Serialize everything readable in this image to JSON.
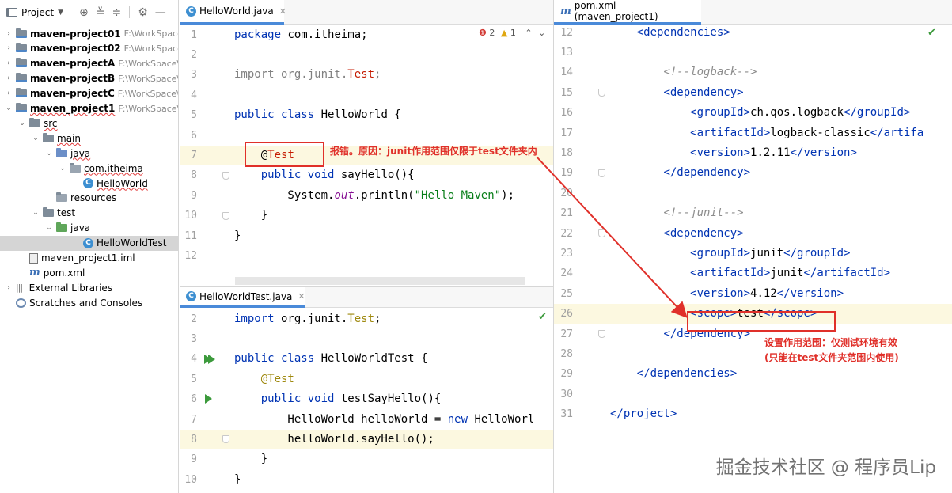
{
  "project": {
    "title": "Project",
    "tree": [
      {
        "label": "maven-project01",
        "path": "F:\\WorkSpace\\it",
        "bold": true,
        "arrow": "›",
        "icon": "module",
        "indent": 0
      },
      {
        "label": "maven-project02",
        "path": "F:\\WorkSpace\\it",
        "bold": true,
        "arrow": "›",
        "icon": "module",
        "indent": 0
      },
      {
        "label": "maven-projectA",
        "path": "F:\\WorkSpace\\it",
        "bold": true,
        "arrow": "›",
        "icon": "module",
        "indent": 0
      },
      {
        "label": "maven-projectB",
        "path": "F:\\WorkSpace\\it",
        "bold": true,
        "arrow": "›",
        "icon": "module",
        "indent": 0
      },
      {
        "label": "maven-projectC",
        "path": "F:\\WorkSpace\\it",
        "bold": true,
        "arrow": "›",
        "icon": "module",
        "indent": 0
      },
      {
        "label": "maven_project1",
        "path": "F:\\WorkSpace\\it",
        "bold": true,
        "arrow": "⌄",
        "icon": "module",
        "indent": 0,
        "squiggle": true
      },
      {
        "label": "src",
        "path": "",
        "arrow": "⌄",
        "icon": "folder",
        "indent": 1,
        "squiggle": true
      },
      {
        "label": "main",
        "path": "",
        "arrow": "⌄",
        "icon": "folder",
        "indent": 2,
        "squiggle": true
      },
      {
        "label": "java",
        "path": "",
        "arrow": "⌄",
        "icon": "src-folder",
        "indent": 3,
        "squiggle": true
      },
      {
        "label": "com.itheima",
        "path": "",
        "arrow": "⌄",
        "icon": "package",
        "indent": 4,
        "squiggle": true
      },
      {
        "label": "HelloWorld",
        "path": "",
        "arrow": "",
        "icon": "class",
        "indent": 5,
        "squiggle": true
      },
      {
        "label": "resources",
        "path": "",
        "arrow": "",
        "icon": "res-folder",
        "indent": 3
      },
      {
        "label": "test",
        "path": "",
        "arrow": "⌄",
        "icon": "folder",
        "indent": 2
      },
      {
        "label": "java",
        "path": "",
        "arrow": "⌄",
        "icon": "test-folder",
        "indent": 3
      },
      {
        "label": "HelloWorldTest",
        "path": "",
        "arrow": "",
        "icon": "class",
        "indent": 5,
        "selected": true
      },
      {
        "label": "maven_project1.iml",
        "path": "",
        "arrow": "",
        "icon": "iml",
        "indent": 1
      },
      {
        "label": "pom.xml",
        "path": "",
        "arrow": "",
        "icon": "maven",
        "indent": 1
      },
      {
        "label": "External Libraries",
        "path": "",
        "arrow": "›",
        "icon": "libs",
        "indent": 0
      },
      {
        "label": "Scratches and Consoles",
        "path": "",
        "arrow": "",
        "icon": "scratch",
        "indent": 0
      }
    ]
  },
  "editor1": {
    "tab": "HelloWorld.java",
    "inspection": {
      "errors": "2",
      "warnings": "1"
    },
    "lines": [
      {
        "n": "1",
        "html": "<span class='kw'>package</span> com.itheima;"
      },
      {
        "n": "2",
        "html": ""
      },
      {
        "n": "3",
        "html": "<span class='gr'>import org.junit.</span><span class='err'>Test</span><span class='gr'>;</span>"
      },
      {
        "n": "4",
        "html": ""
      },
      {
        "n": "5",
        "html": "<span class='kw'>public class</span> HelloWorld {"
      },
      {
        "n": "6",
        "html": ""
      },
      {
        "n": "7",
        "html": "    @<span class='err'>Test</span>",
        "hl": true
      },
      {
        "n": "8",
        "html": "    <span class='kw'>public void</span> sayHello(){"
      },
      {
        "n": "9",
        "html": "        System.<span class='fi'>out</span>.println(<span class='st'>\"Hello Maven\"</span>);"
      },
      {
        "n": "10",
        "html": "    }"
      },
      {
        "n": "11",
        "html": "}"
      },
      {
        "n": "12",
        "html": ""
      }
    ],
    "note": "报错。原因：junit作用范围仅限于test文件夹内"
  },
  "editor2": {
    "tab": "HelloWorldTest.java",
    "lines": [
      {
        "n": "2",
        "html": "<span class='kw'>import</span> org.junit.<span class='an'>Test</span>;"
      },
      {
        "n": "3",
        "html": ""
      },
      {
        "n": "4",
        "html": "<span class='kw'>public class</span> HelloWorldTest {"
      },
      {
        "n": "5",
        "html": "    <span class='an'>@Test</span>"
      },
      {
        "n": "6",
        "html": "    <span class='kw'>public void</span> testSayHello(){"
      },
      {
        "n": "7",
        "html": "        HelloWorld helloWorld = <span class='kw'>new</span> HelloWorl"
      },
      {
        "n": "8",
        "html": "        helloWorld.sayHello();",
        "hl": true
      },
      {
        "n": "9",
        "html": "    }"
      },
      {
        "n": "10",
        "html": "}"
      }
    ]
  },
  "editor3": {
    "tab": "pom.xml (maven_project1)",
    "lines": [
      {
        "n": "12",
        "html": "    <span class='tg'>&lt;dependencies&gt;</span>"
      },
      {
        "n": "13",
        "html": ""
      },
      {
        "n": "14",
        "html": "        <span class='cm'>&lt;!--logback--&gt;</span>"
      },
      {
        "n": "15",
        "html": "        <span class='tg'>&lt;dependency&gt;</span>"
      },
      {
        "n": "16",
        "html": "            <span class='tg'>&lt;groupId&gt;</span>ch.qos.logback<span class='tg'>&lt;/groupId&gt;</span>"
      },
      {
        "n": "17",
        "html": "            <span class='tg'>&lt;artifactId&gt;</span>logback-classic<span class='tg'>&lt;/artifa</span>"
      },
      {
        "n": "18",
        "html": "            <span class='tg'>&lt;version&gt;</span>1.2.11<span class='tg'>&lt;/version&gt;</span>"
      },
      {
        "n": "19",
        "html": "        <span class='tg'>&lt;/dependency&gt;</span>"
      },
      {
        "n": "20",
        "html": ""
      },
      {
        "n": "21",
        "html": "        <span class='cm'>&lt;!--junit--&gt;</span>"
      },
      {
        "n": "22",
        "html": "        <span class='tg'>&lt;dependency&gt;</span>"
      },
      {
        "n": "23",
        "html": "            <span class='tg'>&lt;groupId&gt;</span>junit<span class='tg'>&lt;/groupId&gt;</span>"
      },
      {
        "n": "24",
        "html": "            <span class='tg'>&lt;artifactId&gt;</span>junit<span class='tg'>&lt;/artifactId&gt;</span>"
      },
      {
        "n": "25",
        "html": "            <span class='tg'>&lt;version&gt;</span>4.12<span class='tg'>&lt;/version&gt;</span>"
      },
      {
        "n": "26",
        "html": "            <span class='tg'>&lt;scope&gt;</span>test<span class='tg'>&lt;/scope&gt;</span>",
        "hl": true
      },
      {
        "n": "27",
        "html": "        <span class='tg'>&lt;/dependency&gt;</span>"
      },
      {
        "n": "28",
        "html": ""
      },
      {
        "n": "29",
        "html": "    <span class='tg'>&lt;/dependencies&gt;</span>"
      },
      {
        "n": "30",
        "html": ""
      },
      {
        "n": "31",
        "html": "<span class='tg'>&lt;/project&gt;</span>"
      }
    ],
    "note_line1": "设置作用范围：仅测试环境有效",
    "note_line2": "(只能在test文件夹范围内使用)"
  },
  "watermark": "掘金技术社区 @ 程序员Lip",
  "colors": {
    "keyword": "#0033b3",
    "annotation": "#9e880d",
    "error": "#c51a00",
    "callout": "#e0302a",
    "string": "#067d17"
  }
}
